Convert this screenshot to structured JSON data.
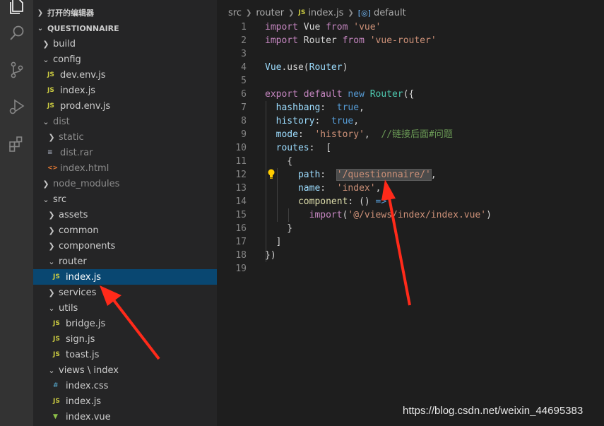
{
  "activity_bar": {
    "icons": [
      "explorer-icon",
      "search-icon",
      "source-control-icon",
      "run-debug-icon",
      "extensions-icon"
    ]
  },
  "explorer": {
    "open_editors_label": "打开的编辑器",
    "project_label": "QUESTIONNAIRE",
    "tree": [
      {
        "label": "build",
        "type": "folder",
        "expanded": false,
        "depth": 1
      },
      {
        "label": "config",
        "type": "folder",
        "expanded": true,
        "depth": 1
      },
      {
        "label": "dev.env.js",
        "type": "js",
        "depth": 2
      },
      {
        "label": "index.js",
        "type": "js",
        "depth": 2
      },
      {
        "label": "prod.env.js",
        "type": "js",
        "depth": 2
      },
      {
        "label": "dist",
        "type": "folder",
        "expanded": true,
        "depth": 1,
        "dim": true
      },
      {
        "label": "static",
        "type": "folder",
        "expanded": false,
        "depth": 2,
        "dim": true
      },
      {
        "label": "dist.rar",
        "type": "rar",
        "depth": 2,
        "dim": true
      },
      {
        "label": "index.html",
        "type": "html",
        "depth": 2,
        "dim": true
      },
      {
        "label": "node_modules",
        "type": "folder",
        "expanded": false,
        "depth": 1,
        "dim": true
      },
      {
        "label": "src",
        "type": "folder",
        "expanded": true,
        "depth": 1
      },
      {
        "label": "assets",
        "type": "folder",
        "expanded": false,
        "depth": 2
      },
      {
        "label": "common",
        "type": "folder",
        "expanded": false,
        "depth": 2
      },
      {
        "label": "components",
        "type": "folder",
        "expanded": false,
        "depth": 2
      },
      {
        "label": "router",
        "type": "folder",
        "expanded": true,
        "depth": 2
      },
      {
        "label": "index.js",
        "type": "js",
        "depth": 3,
        "selected": true
      },
      {
        "label": "services",
        "type": "folder",
        "expanded": false,
        "depth": 2
      },
      {
        "label": "utils",
        "type": "folder",
        "expanded": true,
        "depth": 2
      },
      {
        "label": "bridge.js",
        "type": "js",
        "depth": 3
      },
      {
        "label": "sign.js",
        "type": "js",
        "depth": 3
      },
      {
        "label": "toast.js",
        "type": "js",
        "depth": 3
      },
      {
        "label": "views \\ index",
        "type": "folder",
        "expanded": true,
        "depth": 2
      },
      {
        "label": "index.css",
        "type": "css",
        "depth": 3
      },
      {
        "label": "index.js",
        "type": "js",
        "depth": 3
      },
      {
        "label": "index.vue",
        "type": "vue",
        "depth": 3
      }
    ]
  },
  "breadcrumb": {
    "items": [
      "src",
      "router",
      "index.js",
      "default"
    ],
    "js_badge": "JS"
  },
  "file_badges": {
    "js": "JS",
    "html": "<>",
    "rar": "≡",
    "css": "#",
    "vue": "▼"
  },
  "code": {
    "line_numbers": [
      "1",
      "2",
      "3",
      "4",
      "5",
      "6",
      "7",
      "8",
      "9",
      "10",
      "11",
      "12",
      "13",
      "14",
      "15",
      "16",
      "17",
      "18",
      "19"
    ],
    "lines": [
      [
        [
          "kw2",
          "import"
        ],
        [
          "",
          "Vue"
        ],
        [
          "kw2",
          "from"
        ],
        [
          "str",
          "'vue'"
        ]
      ],
      [
        [
          "kw2",
          "import"
        ],
        [
          "",
          "Router"
        ],
        [
          "kw2",
          "from"
        ],
        [
          "str",
          "'vue-router'"
        ]
      ],
      [],
      [
        [
          "var",
          "Vue"
        ],
        [
          "",
          ".use("
        ],
        [
          "var",
          "Router"
        ],
        [
          "",
          ")"
        ]
      ],
      [],
      [
        [
          "kw2",
          "export"
        ],
        [
          "kw2",
          "default"
        ],
        [
          "kw",
          "new"
        ],
        [
          "fn",
          "Router"
        ],
        [
          "",
          "({"
        ]
      ],
      [
        [
          "prop",
          "  hashbang"
        ],
        [
          "",
          ":"
        ],
        [
          "kw",
          "true"
        ],
        [
          "",
          ","
        ]
      ],
      [
        [
          "prop",
          "  history"
        ],
        [
          "",
          ":"
        ],
        [
          "kw",
          "true"
        ],
        [
          "",
          ","
        ]
      ],
      [
        [
          "prop",
          "  mode"
        ],
        [
          "",
          ":"
        ],
        [
          "str",
          "'history'"
        ],
        [
          "",
          ","
        ],
        [
          "cm",
          "//链接后面#问题"
        ]
      ],
      [
        [
          "prop",
          "  routes"
        ],
        [
          "",
          ":"
        ],
        [
          "",
          "["
        ]
      ],
      [
        [
          "",
          "    {"
        ]
      ],
      [
        [
          "prop",
          "      path"
        ],
        [
          "",
          ":"
        ],
        [
          "str",
          "'/questionnaire/'"
        ],
        [
          "",
          ","
        ]
      ],
      [
        [
          "prop",
          "      name"
        ],
        [
          "",
          ":"
        ],
        [
          "str",
          "'index'"
        ],
        [
          "",
          ","
        ]
      ],
      [
        [
          "mth",
          "      component"
        ],
        [
          "",
          ":"
        ],
        [
          "",
          "()"
        ],
        [
          "kw",
          "=>"
        ]
      ],
      [
        [
          "kw2",
          "        import"
        ],
        [
          "",
          "("
        ],
        [
          "str",
          "'@/views/index/index.vue'"
        ],
        [
          "",
          ")"
        ]
      ],
      [
        [
          "",
          "    }"
        ]
      ],
      [
        [
          "",
          "  ]"
        ]
      ],
      [
        [
          "",
          "})"
        ]
      ],
      []
    ]
  },
  "watermark": "https://blog.csdn.net/weixin_44695383",
  "colors": {
    "selection": "#094771",
    "annotation_arrow": "#ff2a1a"
  }
}
